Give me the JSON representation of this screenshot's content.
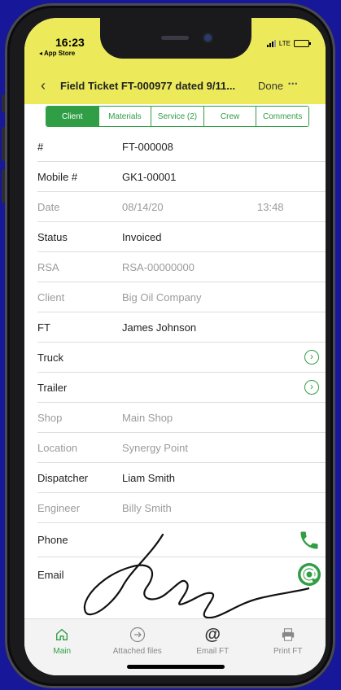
{
  "status_bar": {
    "time": "16:23",
    "back_app": "◂ App Store",
    "network": "LTE"
  },
  "navbar": {
    "back_icon": "chevron-left-icon",
    "title": "Field Ticket FT-000977 dated 9/11...",
    "done_label": "Done",
    "more_label": "•••"
  },
  "tabs": [
    {
      "label": "Client",
      "active": true
    },
    {
      "label": "Materials",
      "active": false
    },
    {
      "label": "Service (2)",
      "active": false
    },
    {
      "label": "Crew",
      "active": false
    },
    {
      "label": "Comments",
      "active": false
    }
  ],
  "fields": {
    "number": {
      "label": "#",
      "value": "FT-000008"
    },
    "mobile": {
      "label": "Mobile #",
      "value": "GK1-00001"
    },
    "date": {
      "label": "Date",
      "value": "08/14/20",
      "time": "13:48"
    },
    "status": {
      "label": "Status",
      "value": "Invoiced"
    },
    "rsa": {
      "label": "RSA",
      "value": "RSA-00000000"
    },
    "client": {
      "label": "Client",
      "value": "Big Oil Company"
    },
    "ft": {
      "label": "FT",
      "value": "James Johnson"
    },
    "truck": {
      "label": "Truck",
      "value": ""
    },
    "trailer": {
      "label": "Trailer",
      "value": ""
    },
    "shop": {
      "label": "Shop",
      "value": "Main Shop"
    },
    "location": {
      "label": "Location",
      "value": "Synergy Point"
    },
    "dispatcher": {
      "label": "Dispatcher",
      "value": "Liam Smith"
    },
    "engineer": {
      "label": "Engineer",
      "value": "Billy Smith"
    },
    "phone": {
      "label": "Phone"
    },
    "email": {
      "label": "Email"
    }
  },
  "bottom_bar": [
    {
      "label": "Main",
      "icon": "home-icon",
      "active": true
    },
    {
      "label": "Attached files",
      "icon": "arrow-circle-icon",
      "active": false
    },
    {
      "label": "Email FT",
      "icon": "at-icon",
      "active": false
    },
    {
      "label": "Print FT",
      "icon": "printer-icon",
      "active": false
    }
  ],
  "colors": {
    "accent_green": "#2f9e44",
    "header_yellow": "#ecea5b",
    "background_blue": "#17179a"
  }
}
